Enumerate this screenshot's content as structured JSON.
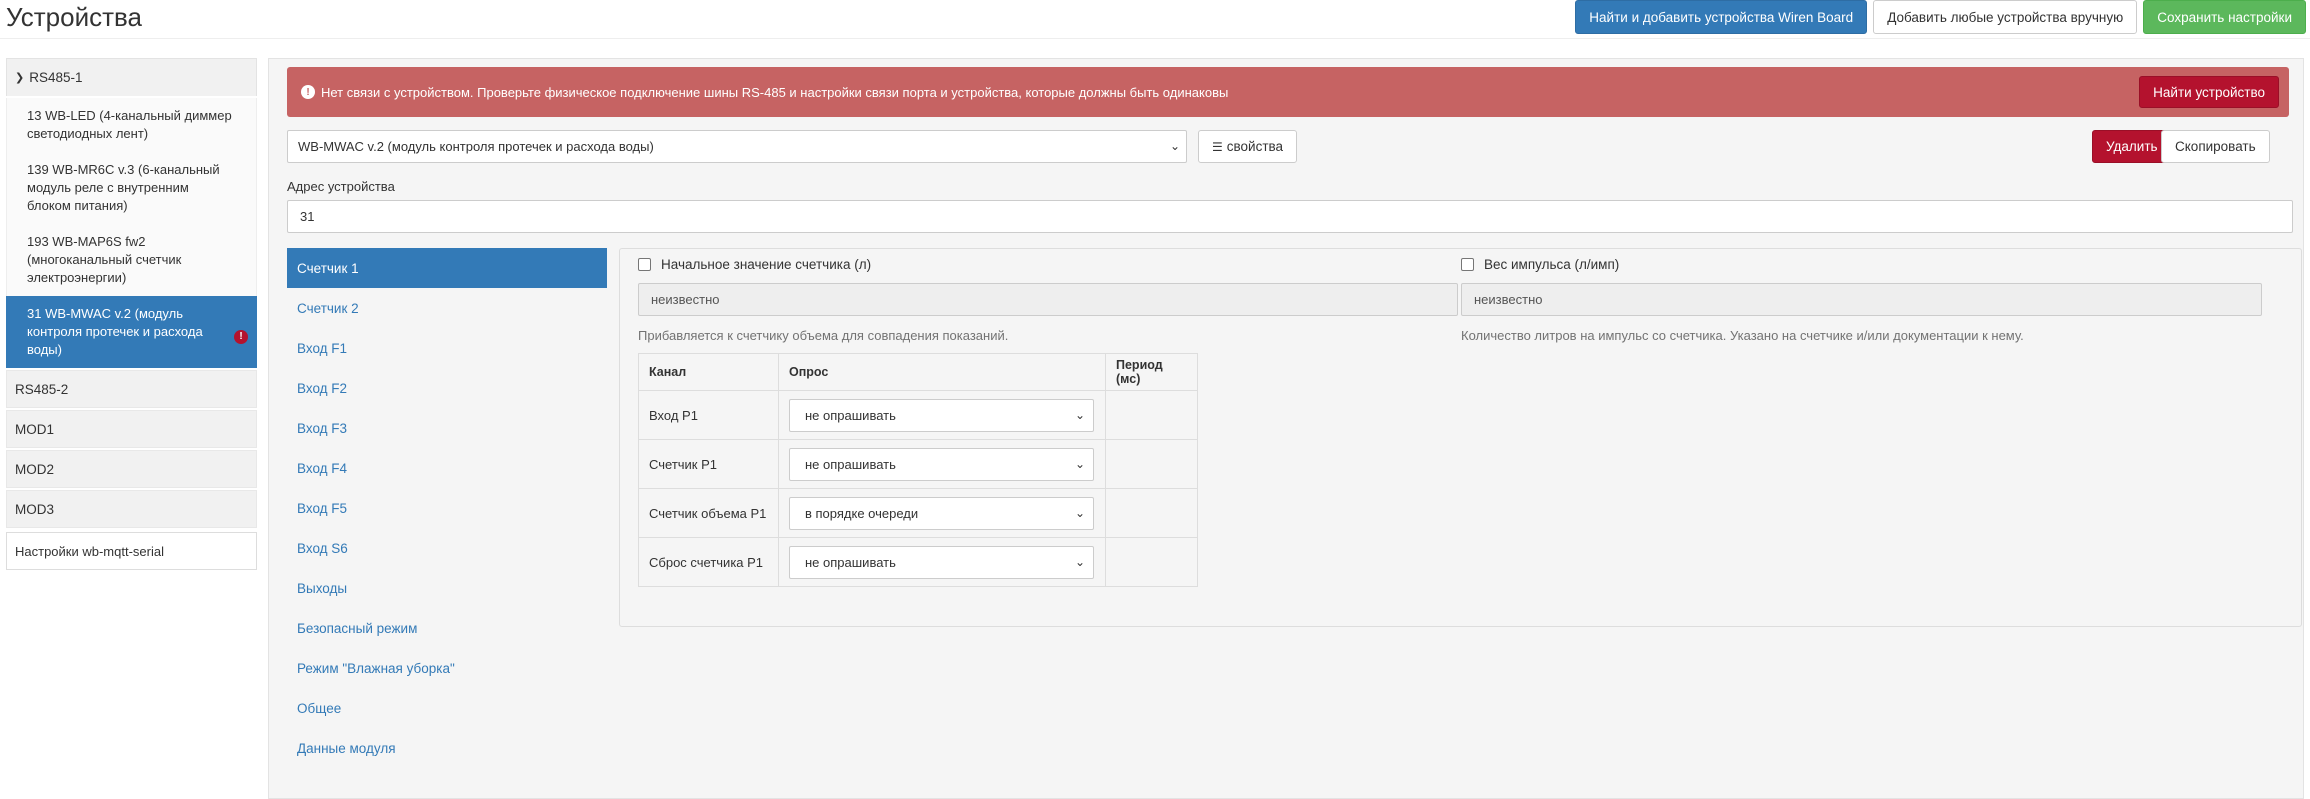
{
  "header": {
    "title": "Устройства",
    "btn_scan": "Найти и добавить устройства Wiren Board",
    "btn_add_manual": "Добавить любые устройства вручную",
    "btn_save": "Сохранить настройки"
  },
  "sidebar": {
    "port_rs485_1": "RS485-1",
    "devices": [
      "13 WB-LED (4-канальный диммер светодиодных лент)",
      "139 WB-MR6C v.3 (6-канальный модуль реле с внутренним блоком питания)",
      "193 WB-MAP6S fw2 (многоканальный счетчик электроэнергии)",
      "31 WB-MWAC v.2 (модуль контроля протечек и расхода воды)"
    ],
    "ports": [
      "RS485-2",
      "MOD1",
      "MOD2",
      "MOD3"
    ],
    "settings": "Настройки wb-mqtt-serial"
  },
  "alert": {
    "message": "Нет связи с устройством. Проверьте физическое подключение шины RS-485 и настройки связи порта и устройства, которые должны быть одинаковы",
    "button": "Найти устройство"
  },
  "device": {
    "selected": "WB-MWAC v.2 (модуль контроля протечек и расхода воды)",
    "props_button": "свойства",
    "delete_button": "Удалить",
    "copy_button": "Скопировать",
    "address_label": "Адрес устройства",
    "address_value": "31"
  },
  "tabs": [
    "Счетчик 1",
    "Счетчик 2",
    "Вход F1",
    "Вход F2",
    "Вход F3",
    "Вход F4",
    "Вход F5",
    "Вход S6",
    "Выходы",
    "Безопасный режим",
    "Режим \"Влажная уборка\"",
    "Общее",
    "Данные модуля"
  ],
  "counter": {
    "initial_label": "Начальное значение счетчика (л)",
    "initial_value": "неизвестно",
    "initial_help": "Прибавляется к счетчику объема для совпадения показаний.",
    "pulse_label": "Вес импульса (л/имп)",
    "pulse_value": "неизвестно",
    "pulse_help": "Количество литров на импульс со счетчика. Указано на счетчике и/или документации к нему."
  },
  "table": {
    "headers": [
      "Канал",
      "Опрос",
      "Период (мс)"
    ],
    "rows": [
      {
        "channel": "Вход P1",
        "poll": "не опрашивать",
        "period": ""
      },
      {
        "channel": "Счетчик P1",
        "poll": "не опрашивать",
        "period": ""
      },
      {
        "channel": "Счетчик объема P1",
        "poll": "в порядке очереди",
        "period": ""
      },
      {
        "channel": "Сброс счетчика P1",
        "poll": "не опрашивать",
        "period": ""
      }
    ]
  }
}
